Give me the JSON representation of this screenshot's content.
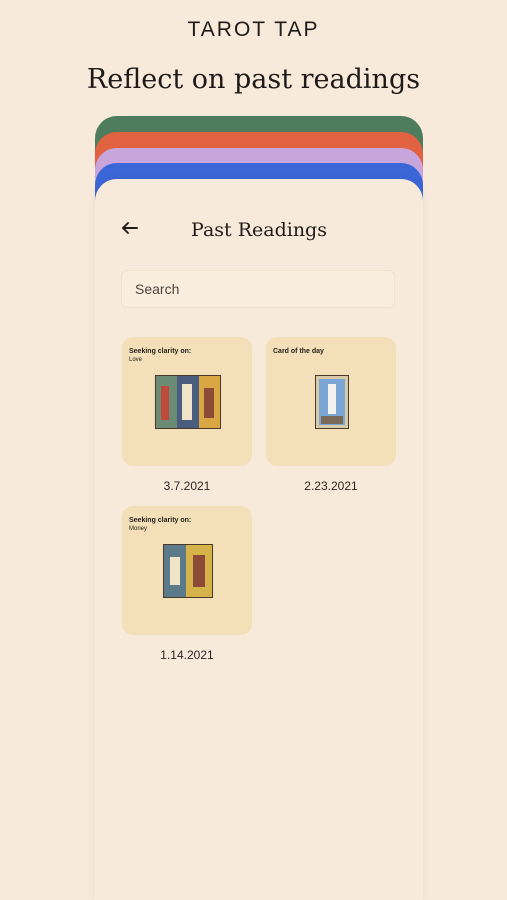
{
  "app": {
    "brand": "TAROT TAP",
    "headline": "Reflect on past readings"
  },
  "screen": {
    "title": "Past Readings",
    "search_placeholder": "Search",
    "readings": [
      {
        "label": "Seeking clarity on:",
        "topic": "Love",
        "date": "3.7.2021"
      },
      {
        "label": "Card of the day",
        "topic": "",
        "date": "2.23.2021"
      },
      {
        "label": "Seeking clarity on:",
        "topic": "Money",
        "date": "1.14.2021"
      }
    ]
  },
  "colors": {
    "background": "#f8eadb",
    "stripe_green": "#4e7d5d",
    "stripe_orange": "#e06240",
    "stripe_lavender": "#c8a6dc",
    "stripe_blue": "#3b66d7",
    "tile": "#f3dfb8"
  },
  "icons": {
    "back": "arrow-left-icon"
  }
}
